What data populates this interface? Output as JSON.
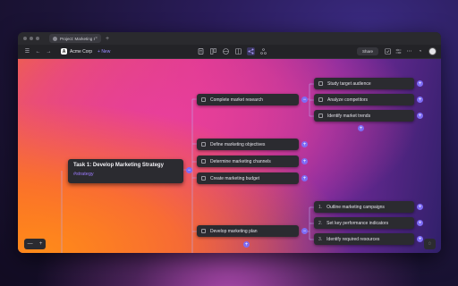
{
  "window": {
    "tab_title": "Project: Marketing St...",
    "tab_close": "×",
    "new_tab": "+"
  },
  "toolbar": {
    "workspace_logo": "A",
    "workspace_name": "Acme Corp",
    "new_label": "+ New",
    "share_label": "Share"
  },
  "icons": {
    "sidebar": "☰",
    "back": "←",
    "forward": "→",
    "more": "⋯",
    "bell": "◔",
    "zoom_out": "—",
    "zoom_in": "+",
    "chat": "◌"
  },
  "mindmap": {
    "root": {
      "title": "Task 1: Develop Marketing Strategy",
      "tag": "#strategy"
    },
    "branches": [
      {
        "label": "Complete market research"
      },
      {
        "label": "Define marketing objectives"
      },
      {
        "label": "Determine marketing channels"
      },
      {
        "label": "Create marketing budget"
      },
      {
        "label": "Develop marketing plan"
      }
    ],
    "research_children": [
      {
        "label": "Study target audience"
      },
      {
        "label": "Analyze competitors"
      },
      {
        "label": "Identify market trends"
      }
    ],
    "plan_children": [
      {
        "num": "1.",
        "label": "Outline marketing campaigns"
      },
      {
        "num": "2.",
        "label": "Set key performance indicators"
      },
      {
        "num": "3.",
        "label": "Identify required resources"
      }
    ]
  },
  "colors": {
    "accent": "#7d6cf5",
    "tag": "#9d7bff",
    "node_bg": "#2b2b30"
  }
}
